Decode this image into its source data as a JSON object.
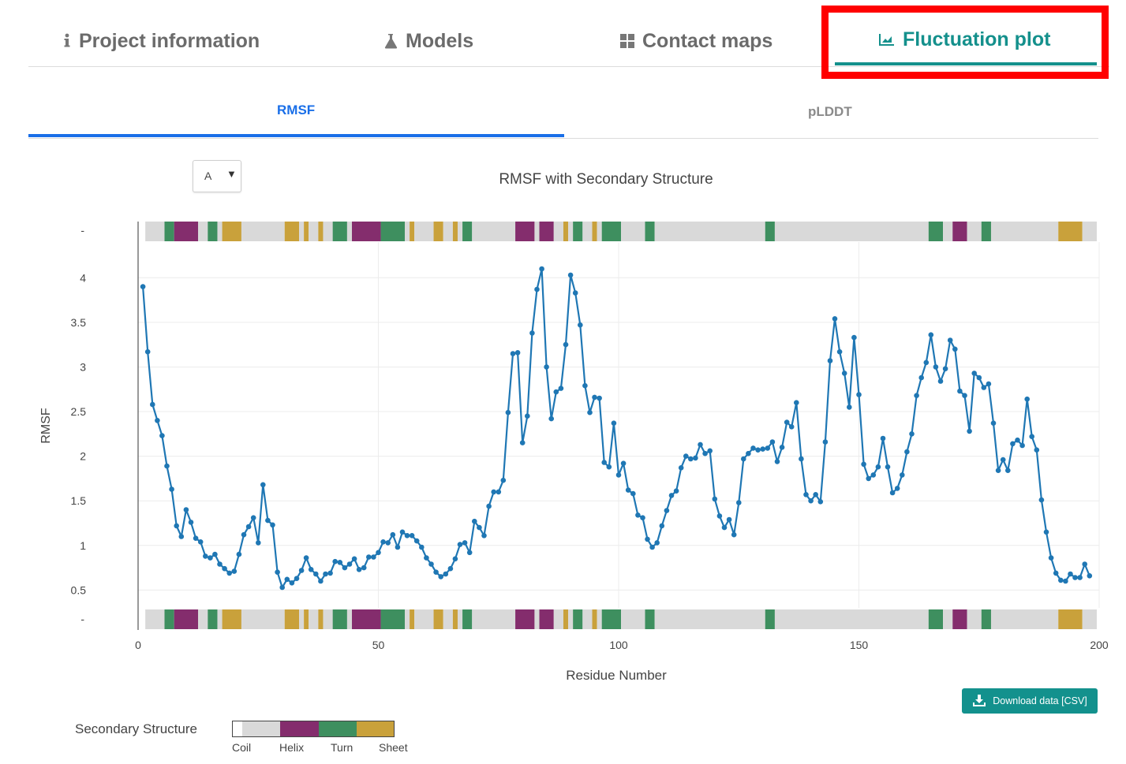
{
  "main_tabs": [
    {
      "label": "Project information",
      "icon": "info-icon",
      "active": false
    },
    {
      "label": "Models",
      "icon": "flask-icon",
      "active": false
    },
    {
      "label": "Contact maps",
      "icon": "grid-icon",
      "active": false
    },
    {
      "label": "Fluctuation plot",
      "icon": "area-chart-icon",
      "active": true
    }
  ],
  "sub_tabs": [
    {
      "label": "RMSF",
      "active": true
    },
    {
      "label": "pLDDT",
      "active": false
    }
  ],
  "chain_select": {
    "value": "A"
  },
  "download_button": {
    "label": "Download data [CSV]",
    "icon": "download-icon"
  },
  "legend": {
    "title": "Secondary Structure",
    "items": [
      {
        "label": "Coil",
        "color": "#d9d9d9"
      },
      {
        "label": "Helix",
        "color": "#842d6d"
      },
      {
        "label": "Turn",
        "color": "#3e8f5f"
      },
      {
        "label": "Sheet",
        "color": "#c9a13b"
      }
    ]
  },
  "chart_data": {
    "type": "line",
    "title": "RMSF with Secondary Structure",
    "xlabel": "Residue Number",
    "ylabel": "RMSF",
    "xlim": [
      0,
      200
    ],
    "ylim": [
      0.3,
      4.4
    ],
    "xticks": [
      0,
      50,
      100,
      150,
      200
    ],
    "yticks": [
      0.5,
      1,
      1.5,
      2,
      2.5,
      3,
      3.5,
      4
    ],
    "track_tick_label": "-",
    "line_color": "#1f77b4",
    "grid": true,
    "series": [
      {
        "x_start": 1,
        "x_step": 1,
        "values": [
          3.9,
          3.17,
          2.58,
          2.4,
          2.23,
          1.89,
          1.63,
          1.22,
          1.1,
          1.4,
          1.26,
          1.08,
          1.04,
          0.88,
          0.86,
          0.9,
          0.79,
          0.74,
          0.69,
          0.71,
          0.9,
          1.12,
          1.21,
          1.31,
          1.03,
          1.68,
          1.28,
          1.23,
          0.7,
          0.53,
          0.62,
          0.58,
          0.63,
          0.72,
          0.86,
          0.73,
          0.68,
          0.6,
          0.68,
          0.69,
          0.82,
          0.81,
          0.75,
          0.79,
          0.85,
          0.73,
          0.75,
          0.87,
          0.87,
          0.92,
          1.04,
          1.03,
          1.12,
          0.98,
          1.15,
          1.11,
          1.11,
          1.05,
          0.98,
          0.86,
          0.79,
          0.7,
          0.65,
          0.68,
          0.74,
          0.85,
          1.01,
          1.03,
          0.92,
          1.27,
          1.2,
          1.11,
          1.44,
          1.6,
          1.6,
          1.73,
          2.49,
          3.15,
          3.16,
          2.15,
          2.45,
          3.38,
          3.87,
          4.1,
          3.0,
          2.42,
          2.72,
          2.76,
          3.25,
          4.03,
          3.83,
          3.47,
          2.79,
          2.49,
          2.66,
          2.65,
          1.93,
          1.88,
          2.37,
          1.79,
          1.92,
          1.62,
          1.58,
          1.34,
          1.31,
          1.07,
          0.98,
          1.03,
          1.22,
          1.39,
          1.56,
          1.61,
          1.87,
          2.0,
          1.97,
          1.98,
          2.13,
          2.03,
          2.06,
          1.52,
          1.33,
          1.2,
          1.29,
          1.12,
          1.48,
          1.97,
          2.03,
          2.09,
          2.07,
          2.08,
          2.09,
          2.16,
          1.94,
          2.1,
          2.38,
          2.33,
          2.6,
          1.97,
          1.57,
          1.5,
          1.57,
          1.49,
          2.16,
          3.07,
          3.54,
          3.17,
          2.93,
          2.55,
          3.33,
          2.69,
          1.91,
          1.75,
          1.79,
          1.88,
          2.2,
          1.88,
          1.59,
          1.64,
          1.79,
          2.05,
          2.25,
          2.68,
          2.88,
          3.05,
          3.36,
          3.0,
          2.84,
          2.98,
          3.3,
          3.2,
          2.73,
          2.68,
          2.28,
          2.93,
          2.88,
          2.77,
          2.81,
          2.37,
          1.84,
          1.96,
          1.84,
          2.14,
          2.18,
          2.12,
          2.64,
          2.22,
          2.07,
          1.51,
          1.15,
          0.86,
          0.69,
          0.61,
          0.6,
          0.68,
          0.64,
          0.64,
          0.79,
          0.66
        ]
      }
    ],
    "secondary_structure": [
      {
        "start": 0.5,
        "end": 4.5,
        "type": "Coil"
      },
      {
        "start": 4.5,
        "end": 6.5,
        "type": "Turn"
      },
      {
        "start": 6.5,
        "end": 11.5,
        "type": "Helix"
      },
      {
        "start": 11.5,
        "end": 13.5,
        "type": "Coil"
      },
      {
        "start": 13.5,
        "end": 15.5,
        "type": "Turn"
      },
      {
        "start": 15.5,
        "end": 16.5,
        "type": "Coil"
      },
      {
        "start": 16.5,
        "end": 20.5,
        "type": "Sheet"
      },
      {
        "start": 20.5,
        "end": 29.5,
        "type": "Coil"
      },
      {
        "start": 29.5,
        "end": 32.5,
        "type": "Sheet"
      },
      {
        "start": 32.5,
        "end": 33.5,
        "type": "Coil"
      },
      {
        "start": 33.5,
        "end": 34.5,
        "type": "Sheet"
      },
      {
        "start": 34.5,
        "end": 36.5,
        "type": "Coil"
      },
      {
        "start": 36.5,
        "end": 37.5,
        "type": "Sheet"
      },
      {
        "start": 37.5,
        "end": 39.5,
        "type": "Coil"
      },
      {
        "start": 39.5,
        "end": 42.5,
        "type": "Turn"
      },
      {
        "start": 42.5,
        "end": 43.5,
        "type": "Coil"
      },
      {
        "start": 43.5,
        "end": 49.5,
        "type": "Helix"
      },
      {
        "start": 49.5,
        "end": 54.5,
        "type": "Turn"
      },
      {
        "start": 54.5,
        "end": 55.5,
        "type": "Coil"
      },
      {
        "start": 55.5,
        "end": 56.5,
        "type": "Sheet"
      },
      {
        "start": 56.5,
        "end": 60.5,
        "type": "Coil"
      },
      {
        "start": 60.5,
        "end": 62.5,
        "type": "Sheet"
      },
      {
        "start": 62.5,
        "end": 64.5,
        "type": "Coil"
      },
      {
        "start": 64.5,
        "end": 65.5,
        "type": "Sheet"
      },
      {
        "start": 65.5,
        "end": 66.5,
        "type": "Coil"
      },
      {
        "start": 66.5,
        "end": 68.5,
        "type": "Turn"
      },
      {
        "start": 68.5,
        "end": 77.5,
        "type": "Coil"
      },
      {
        "start": 77.5,
        "end": 81.5,
        "type": "Helix"
      },
      {
        "start": 81.5,
        "end": 82.5,
        "type": "Coil"
      },
      {
        "start": 82.5,
        "end": 85.5,
        "type": "Helix"
      },
      {
        "start": 85.5,
        "end": 87.5,
        "type": "Coil"
      },
      {
        "start": 87.5,
        "end": 88.5,
        "type": "Sheet"
      },
      {
        "start": 88.5,
        "end": 89.5,
        "type": "Coil"
      },
      {
        "start": 89.5,
        "end": 91.5,
        "type": "Turn"
      },
      {
        "start": 91.5,
        "end": 93.5,
        "type": "Coil"
      },
      {
        "start": 93.5,
        "end": 94.5,
        "type": "Sheet"
      },
      {
        "start": 94.5,
        "end": 95.5,
        "type": "Coil"
      },
      {
        "start": 95.5,
        "end": 99.5,
        "type": "Turn"
      },
      {
        "start": 99.5,
        "end": 104.5,
        "type": "Coil"
      },
      {
        "start": 104.5,
        "end": 106.5,
        "type": "Turn"
      },
      {
        "start": 106.5,
        "end": 129.5,
        "type": "Coil"
      },
      {
        "start": 129.5,
        "end": 131.5,
        "type": "Turn"
      },
      {
        "start": 131.5,
        "end": 163.5,
        "type": "Coil"
      },
      {
        "start": 163.5,
        "end": 166.5,
        "type": "Turn"
      },
      {
        "start": 166.5,
        "end": 168.5,
        "type": "Coil"
      },
      {
        "start": 168.5,
        "end": 171.5,
        "type": "Helix"
      },
      {
        "start": 171.5,
        "end": 174.5,
        "type": "Coil"
      },
      {
        "start": 174.5,
        "end": 176.5,
        "type": "Turn"
      },
      {
        "start": 176.5,
        "end": 190.5,
        "type": "Coil"
      },
      {
        "start": 190.5,
        "end": 195.5,
        "type": "Sheet"
      },
      {
        "start": 195.5,
        "end": 198.5,
        "type": "Coil"
      }
    ]
  }
}
